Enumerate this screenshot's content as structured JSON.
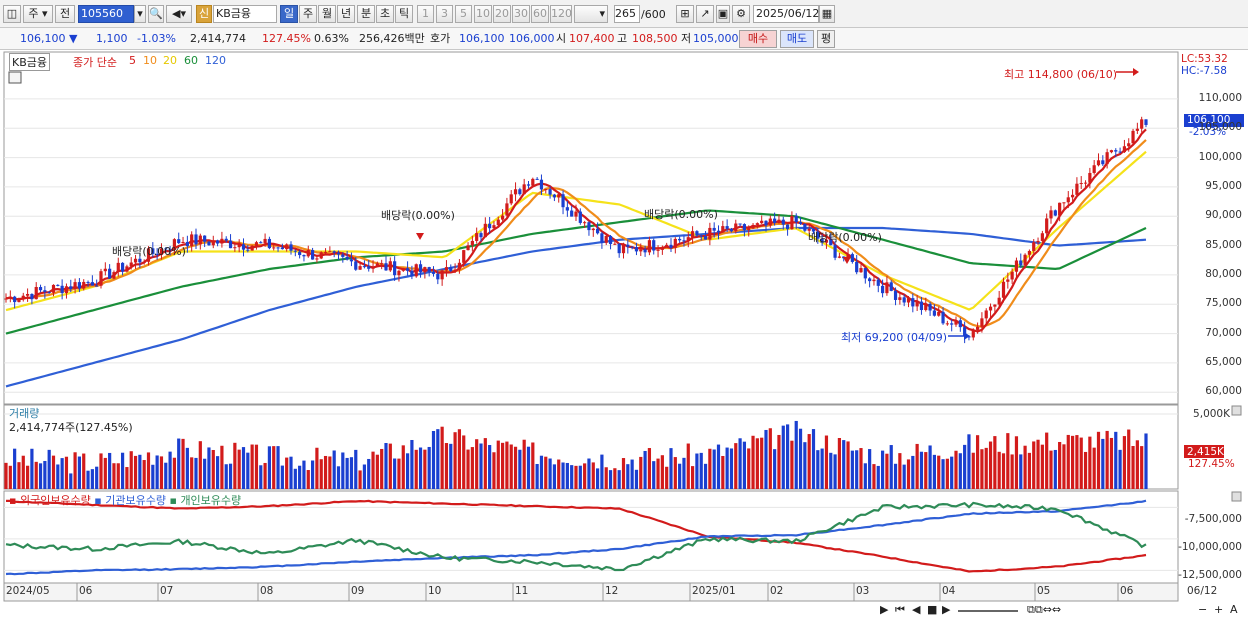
{
  "toolbar": {
    "period_label": "주",
    "prev_label": "전",
    "stock_code": "105560",
    "badge": "신",
    "stock_name": "KB금융",
    "tabs": [
      "일",
      "주",
      "월",
      "년",
      "분",
      "초",
      "틱"
    ],
    "intervals": [
      "1",
      "3",
      "5",
      "10",
      "20",
      "30",
      "60",
      "120"
    ],
    "count_value": "265",
    "count_total": "/600",
    "date": "2025/06/12"
  },
  "quote": {
    "price": "106,100",
    "change": "1,100",
    "change_pct": "-1.03%",
    "volume": "2,414,774",
    "volume_ratio": "127.45%",
    "turnover": "0.63%",
    "amount": "256,426백만",
    "bid_label": "호가",
    "bid1": "106,100",
    "bid2": "106,000",
    "open_label": "시",
    "open": "107,400",
    "high_label": "고",
    "high": "108,500",
    "low_label": "저",
    "low": "105,000",
    "buy_label": "매수",
    "sell_label": "매도",
    "avg_label": "평"
  },
  "price_pane": {
    "stock": "KB금융",
    "ma_label": "종가 단순",
    "ma_periods": [
      "5",
      "10",
      "20",
      "60",
      "120"
    ],
    "ma_colors": [
      "#d21b1b",
      "#f08c1a",
      "#f5e21a",
      "#1a8f3a",
      "#2f5fd6"
    ],
    "lc": "LC:53.32",
    "hc": "HC:-7.58",
    "current_price": "106,100",
    "current_pct": "-2.03%",
    "high_annotation": "최고 114,800 (06/10)",
    "low_annotation": "최저 69,200 (04/09)",
    "dividend_label": "배당락(0.00%)",
    "y_ticks": [
      "110,000",
      "105,000",
      "100,000",
      "95,000",
      "90,000",
      "85,000",
      "80,000",
      "75,000",
      "70,000",
      "65,000",
      "60,000"
    ]
  },
  "volume_pane": {
    "title": "거래량",
    "value": "2,414,774주(127.45%)",
    "y_tick": "5,000K",
    "current": "2,415K",
    "current_pct": "127.45%"
  },
  "holding_pane": {
    "series": [
      "외국인보유수량",
      "기관보유수량",
      "개인보유수량"
    ],
    "series_colors": [
      "#d21b1b",
      "#2f5fd6",
      "#2e8b57"
    ],
    "y_ticks": [
      "-7,500,000",
      "-10,000,000",
      "-12,500,000"
    ]
  },
  "x_axis": {
    "dates": [
      "2024/05",
      "06",
      "07",
      "08",
      "09",
      "10",
      "11",
      "12",
      "2025/01",
      "02",
      "03",
      "04",
      "05",
      "06"
    ],
    "end_date": "06/12"
  },
  "chart_data": {
    "type": "line",
    "title": "KB금융",
    "x": [
      "2024/05",
      "06",
      "07",
      "08",
      "09",
      "10",
      "11",
      "12",
      "2025/01",
      "02",
      "03",
      "04",
      "05",
      "06"
    ],
    "series": [
      {
        "name": "종가",
        "values": [
          76000,
          79000,
          86000,
          85000,
          82000,
          80000,
          97000,
          84000,
          87000,
          89000,
          78000,
          70000,
          92000,
          106100
        ]
      },
      {
        "name": "20",
        "values": [
          74000,
          78000,
          84000,
          84000,
          84000,
          83000,
          94000,
          92000,
          86000,
          88000,
          80000,
          74000,
          88000,
          101000
        ]
      },
      {
        "name": "60",
        "values": [
          70000,
          74000,
          78000,
          81000,
          83000,
          84000,
          87000,
          89000,
          91000,
          90000,
          86000,
          82000,
          81000,
          88000
        ]
      },
      {
        "name": "120",
        "values": [
          61000,
          65000,
          69000,
          74000,
          78000,
          81000,
          84000,
          86000,
          87000,
          88000,
          88000,
          87000,
          85000,
          86000
        ]
      }
    ],
    "ylim": [
      58000,
      118000
    ],
    "volume_values": [
      1.5,
      1.3,
      2.0,
      1.6,
      1.4,
      2.6,
      1.8,
      1.5,
      1.7,
      2.8,
      1.6,
      2.2,
      2.4,
      2.4
    ],
    "holding": {
      "x": [
        "2024/05",
        "06",
        "07",
        "08",
        "09",
        "10",
        "11",
        "12",
        "2025/01",
        "02",
        "03",
        "04",
        "05",
        "06"
      ],
      "series": [
        {
          "name": "외국인보유수량",
          "values": [
            -7.0,
            -7.3,
            -7.6,
            -7.4,
            -7.0,
            -7.2,
            -7.4,
            -7.6,
            -9.8,
            -10.3,
            -11.4,
            -12.6,
            -12.2,
            -11.3
          ]
        },
        {
          "name": "기관보유수량",
          "values": [
            -12.8,
            -12.5,
            -12.4,
            -12.2,
            -11.8,
            -11.5,
            -11.3,
            -10.8,
            -9.8,
            -9.7,
            -8.9,
            -8.0,
            -7.8,
            -7.0
          ]
        },
        {
          "name": "개인보유수량",
          "values": [
            -10.5,
            -10.8,
            -10.2,
            -11.2,
            -10.1,
            -11.5,
            -11.8,
            -12.4,
            -10.0,
            -10.2,
            -7.5,
            -7.3,
            -7.6,
            -10.6
          ]
        }
      ]
    }
  }
}
